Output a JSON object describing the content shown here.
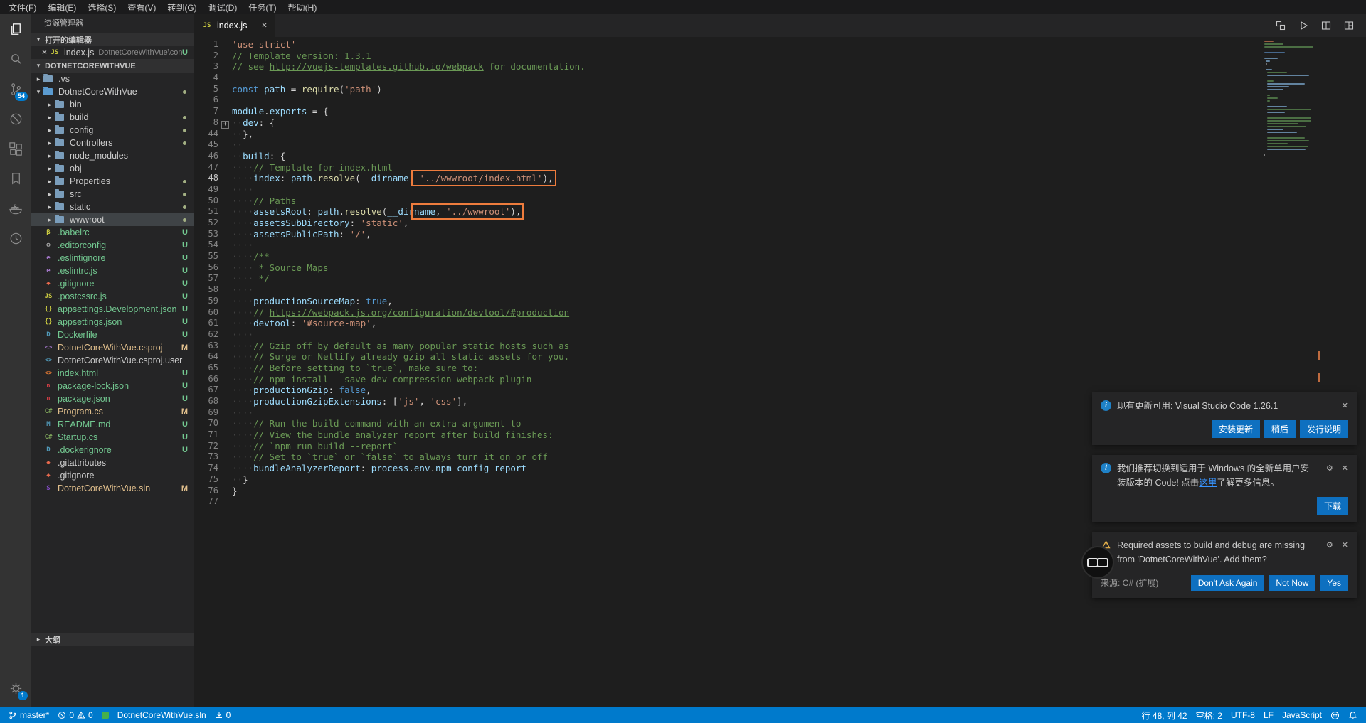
{
  "menu": {
    "items": [
      "文件(F)",
      "编辑(E)",
      "选择(S)",
      "查看(V)",
      "转到(G)",
      "调试(D)",
      "任务(T)",
      "帮助(H)"
    ]
  },
  "activity_bar": {
    "icons": [
      "explorer",
      "search",
      "source-control",
      "debug",
      "extensions",
      "bookmarks",
      "docker",
      "history",
      "settings"
    ],
    "scm_badge": "54",
    "settings_badge": "1"
  },
  "sidebar": {
    "title": "资源管理器",
    "open_editors_label": "打开的编辑器",
    "root_label": "DOTNETCOREWITHVUE",
    "outline_label": "大纲",
    "open_editor_item": {
      "file": "index.js",
      "path": "DotnetCoreWithVue\\con...",
      "badge": "U"
    },
    "tree": [
      {
        "l": ".vs",
        "d": 1,
        "k": "f",
        "tw": "▸",
        "ic": "folder"
      },
      {
        "l": "DotnetCoreWithVue",
        "d": 1,
        "k": "f",
        "tw": "▾",
        "ic": "folder-open",
        "dot": true
      },
      {
        "l": "bin",
        "d": 2,
        "k": "f",
        "tw": "▸",
        "ic": "folder"
      },
      {
        "l": "build",
        "d": 2,
        "k": "f",
        "tw": "▸",
        "ic": "folder",
        "dot": true
      },
      {
        "l": "config",
        "d": 2,
        "k": "f",
        "tw": "▸",
        "ic": "folder",
        "dot": true
      },
      {
        "l": "Controllers",
        "d": 2,
        "k": "f",
        "tw": "▸",
        "ic": "folder",
        "dot": true
      },
      {
        "l": "node_modules",
        "d": 2,
        "k": "f",
        "tw": "▸",
        "ic": "folder"
      },
      {
        "l": "obj",
        "d": 2,
        "k": "f",
        "tw": "▸",
        "ic": "folder"
      },
      {
        "l": "Properties",
        "d": 2,
        "k": "f",
        "tw": "▸",
        "ic": "folder",
        "dot": true
      },
      {
        "l": "src",
        "d": 2,
        "k": "f",
        "tw": "▸",
        "ic": "folder",
        "dot": true
      },
      {
        "l": "static",
        "d": 2,
        "k": "f",
        "tw": "▸",
        "ic": "folder",
        "dot": true
      },
      {
        "l": "wwwroot",
        "d": 2,
        "k": "f",
        "tw": "▸",
        "ic": "folder",
        "dot": true,
        "sel": true
      },
      {
        "l": ".babelrc",
        "d": 1,
        "k": "x",
        "ic": "babel",
        "b": "U",
        "g": "u"
      },
      {
        "l": ".editorconfig",
        "d": 1,
        "k": "x",
        "ic": "editorconfig",
        "b": "U",
        "g": "u"
      },
      {
        "l": ".eslintignore",
        "d": 1,
        "k": "x",
        "ic": "eslint",
        "b": "U",
        "g": "u"
      },
      {
        "l": ".eslintrc.js",
        "d": 1,
        "k": "x",
        "ic": "eslint",
        "b": "U",
        "g": "u"
      },
      {
        "l": ".gitignore",
        "d": 1,
        "k": "x",
        "ic": "git",
        "b": "U",
        "g": "u"
      },
      {
        "l": ".postcssrc.js",
        "d": 1,
        "k": "x",
        "ic": "js",
        "b": "U",
        "g": "u"
      },
      {
        "l": "appsettings.Development.json",
        "d": 1,
        "k": "x",
        "ic": "json",
        "b": "U",
        "g": "u"
      },
      {
        "l": "appsettings.json",
        "d": 1,
        "k": "x",
        "ic": "json",
        "b": "U",
        "g": "u"
      },
      {
        "l": "Dockerfile",
        "d": 1,
        "k": "x",
        "ic": "docker",
        "b": "U",
        "g": "u"
      },
      {
        "l": "DotnetCoreWithVue.csproj",
        "d": 1,
        "k": "x",
        "ic": "csproj",
        "b": "M",
        "g": "m"
      },
      {
        "l": "DotnetCoreWithVue.csproj.user",
        "d": 1,
        "k": "x",
        "ic": "csprojuser"
      },
      {
        "l": "index.html",
        "d": 1,
        "k": "x",
        "ic": "html",
        "b": "U",
        "g": "u"
      },
      {
        "l": "package-lock.json",
        "d": 1,
        "k": "x",
        "ic": "npm",
        "b": "U",
        "g": "u"
      },
      {
        "l": "package.json",
        "d": 1,
        "k": "x",
        "ic": "npm",
        "b": "U",
        "g": "u"
      },
      {
        "l": "Program.cs",
        "d": 1,
        "k": "x",
        "ic": "cs",
        "b": "M",
        "g": "m"
      },
      {
        "l": "README.md",
        "d": 1,
        "k": "x",
        "ic": "md",
        "b": "U",
        "g": "u"
      },
      {
        "l": "Startup.cs",
        "d": 1,
        "k": "x",
        "ic": "cs",
        "b": "U",
        "g": "u"
      },
      {
        "l": ".dockerignore",
        "d": 1,
        "k": "x",
        "ic": "docker",
        "b": "U",
        "g": "u"
      },
      {
        "l": ".gitattributes",
        "d": 1,
        "k": "x",
        "ic": "git"
      },
      {
        "l": ".gitignore",
        "d": 1,
        "k": "x",
        "ic": "git"
      },
      {
        "l": "DotnetCoreWithVue.sln",
        "d": 1,
        "k": "x",
        "ic": "sln",
        "b": "M",
        "g": "m"
      }
    ]
  },
  "editor": {
    "tab": {
      "label": "index.js"
    },
    "tab_actions": [
      "open-changes",
      "run",
      "split-editor",
      "layout"
    ],
    "cursor_line": 48,
    "code": [
      {
        "n": 1,
        "t": [
          [
            "s",
            "'use strict'"
          ]
        ]
      },
      {
        "n": 2,
        "t": [
          [
            "c",
            "// Template version: 1.3.1"
          ]
        ]
      },
      {
        "n": 3,
        "t": [
          [
            "c",
            "// see "
          ],
          [
            "cl",
            "http://vuejs-templates.github.io/webpack"
          ],
          [
            "c",
            " for documentation."
          ]
        ]
      },
      {
        "n": 4,
        "t": []
      },
      {
        "n": 5,
        "t": [
          [
            "k",
            "const"
          ],
          [
            "p",
            " "
          ],
          [
            "v",
            "path"
          ],
          [
            "p",
            " = "
          ],
          [
            "f",
            "require"
          ],
          [
            "p",
            "("
          ],
          [
            "s",
            "'path'"
          ],
          [
            "p",
            ")"
          ]
        ]
      },
      {
        "n": 6,
        "t": []
      },
      {
        "n": 7,
        "t": [
          [
            "v",
            "module"
          ],
          [
            "p",
            "."
          ],
          [
            "v",
            "exports"
          ],
          [
            "p",
            " = {"
          ]
        ]
      },
      {
        "n": 8,
        "fold": true,
        "t": [
          [
            "w",
            "  "
          ],
          [
            "v",
            "dev"
          ],
          [
            "p",
            ": {"
          ]
        ]
      },
      {
        "n": 44,
        "t": [
          [
            "w",
            "  "
          ],
          [
            "p",
            "},"
          ]
        ]
      },
      {
        "n": 45,
        "t": [
          [
            "w",
            "  "
          ]
        ]
      },
      {
        "n": 46,
        "t": [
          [
            "w",
            "  "
          ],
          [
            "v",
            "build"
          ],
          [
            "p",
            ": {"
          ]
        ]
      },
      {
        "n": 47,
        "t": [
          [
            "w",
            "    "
          ],
          [
            "c",
            "// Template for index.html"
          ]
        ]
      },
      {
        "n": 48,
        "caret": true,
        "t": [
          [
            "w",
            "    "
          ],
          [
            "v",
            "index"
          ],
          [
            "p",
            ": "
          ],
          [
            "v",
            "path"
          ],
          [
            "p",
            "."
          ],
          [
            "f",
            "resolve"
          ],
          [
            "p",
            "("
          ],
          [
            "v",
            "__dirname"
          ],
          [
            "p",
            ","
          ],
          [
            "p",
            " ",
            "b"
          ],
          [
            "s",
            "'../wwwroot/index.html'",
            "b"
          ],
          [
            "p",
            "),",
            "b"
          ]
        ]
      },
      {
        "n": 49,
        "t": [
          [
            "w",
            "    "
          ]
        ]
      },
      {
        "n": 50,
        "t": [
          [
            "w",
            "    "
          ],
          [
            "c",
            "// Paths"
          ]
        ]
      },
      {
        "n": 51,
        "t": [
          [
            "w",
            "    "
          ],
          [
            "v",
            "assetsRoot"
          ],
          [
            "p",
            ": "
          ],
          [
            "v",
            "path"
          ],
          [
            "p",
            "."
          ],
          [
            "f",
            "resolve"
          ],
          [
            "p",
            "("
          ],
          [
            "v",
            "__dir"
          ],
          [
            "v",
            "name",
            "b"
          ],
          [
            "p",
            ", ",
            "b"
          ],
          [
            "s",
            "'../wwwroot'",
            "b"
          ],
          [
            "p",
            "),",
            "b"
          ]
        ]
      },
      {
        "n": 52,
        "t": [
          [
            "w",
            "    "
          ],
          [
            "v",
            "assetsSubDirectory"
          ],
          [
            "p",
            ": "
          ],
          [
            "s",
            "'static'"
          ],
          [
            "p",
            ","
          ]
        ]
      },
      {
        "n": 53,
        "t": [
          [
            "w",
            "    "
          ],
          [
            "v",
            "assetsPublicPath"
          ],
          [
            "p",
            ": "
          ],
          [
            "s",
            "'/'"
          ],
          [
            "p",
            ","
          ]
        ]
      },
      {
        "n": 54,
        "t": [
          [
            "w",
            "    "
          ]
        ]
      },
      {
        "n": 55,
        "t": [
          [
            "w",
            "    "
          ],
          [
            "c",
            "/**"
          ]
        ]
      },
      {
        "n": 56,
        "t": [
          [
            "w",
            "    "
          ],
          [
            "c",
            " * Source Maps"
          ]
        ]
      },
      {
        "n": 57,
        "t": [
          [
            "w",
            "    "
          ],
          [
            "c",
            " */"
          ]
        ]
      },
      {
        "n": 58,
        "t": [
          [
            "w",
            "    "
          ]
        ]
      },
      {
        "n": 59,
        "t": [
          [
            "w",
            "    "
          ],
          [
            "v",
            "productionSourceMap"
          ],
          [
            "p",
            ": "
          ],
          [
            "k",
            "true"
          ],
          [
            "p",
            ","
          ]
        ]
      },
      {
        "n": 60,
        "t": [
          [
            "w",
            "    "
          ],
          [
            "c",
            "// "
          ],
          [
            "cl",
            "https://webpack.js.org/configuration/devtool/#production"
          ]
        ]
      },
      {
        "n": 61,
        "t": [
          [
            "w",
            "    "
          ],
          [
            "v",
            "devtool"
          ],
          [
            "p",
            ": "
          ],
          [
            "s",
            "'#source-map'"
          ],
          [
            "p",
            ","
          ]
        ]
      },
      {
        "n": 62,
        "t": [
          [
            "w",
            "    "
          ]
        ]
      },
      {
        "n": 63,
        "t": [
          [
            "w",
            "    "
          ],
          [
            "c",
            "// Gzip off by default as many popular static hosts such as"
          ]
        ]
      },
      {
        "n": 64,
        "t": [
          [
            "w",
            "    "
          ],
          [
            "c",
            "// Surge or Netlify already gzip all static assets for you."
          ]
        ]
      },
      {
        "n": 65,
        "t": [
          [
            "w",
            "    "
          ],
          [
            "c",
            "// Before setting to `true`, make sure to:"
          ]
        ]
      },
      {
        "n": 66,
        "t": [
          [
            "w",
            "    "
          ],
          [
            "c",
            "// npm install --save-dev compression-webpack-plugin"
          ]
        ]
      },
      {
        "n": 67,
        "t": [
          [
            "w",
            "    "
          ],
          [
            "v",
            "productionGzip"
          ],
          [
            "p",
            ": "
          ],
          [
            "k",
            "false"
          ],
          [
            "p",
            ","
          ]
        ]
      },
      {
        "n": 68,
        "t": [
          [
            "w",
            "    "
          ],
          [
            "v",
            "productionGzipExtensions"
          ],
          [
            "p",
            ": ["
          ],
          [
            "s",
            "'js'"
          ],
          [
            "p",
            ", "
          ],
          [
            "s",
            "'css'"
          ],
          [
            "p",
            "],"
          ]
        ]
      },
      {
        "n": 69,
        "t": [
          [
            "w",
            "    "
          ]
        ]
      },
      {
        "n": 70,
        "t": [
          [
            "w",
            "    "
          ],
          [
            "c",
            "// Run the build command with an extra argument to"
          ]
        ]
      },
      {
        "n": 71,
        "t": [
          [
            "w",
            "    "
          ],
          [
            "c",
            "// View the bundle analyzer report after build finishes:"
          ]
        ]
      },
      {
        "n": 72,
        "t": [
          [
            "w",
            "    "
          ],
          [
            "c",
            "// `npm run build --report`"
          ]
        ]
      },
      {
        "n": 73,
        "t": [
          [
            "w",
            "    "
          ],
          [
            "c",
            "// Set to `true` or `false` to always turn it on or off"
          ]
        ]
      },
      {
        "n": 74,
        "t": [
          [
            "w",
            "    "
          ],
          [
            "v",
            "bundleAnalyzerReport"
          ],
          [
            "p",
            ": "
          ],
          [
            "v",
            "process"
          ],
          [
            "p",
            "."
          ],
          [
            "v",
            "env"
          ],
          [
            "p",
            "."
          ],
          [
            "v",
            "npm_config_report"
          ]
        ]
      },
      {
        "n": 75,
        "t": [
          [
            "w",
            "  "
          ],
          [
            "p",
            "}"
          ]
        ]
      },
      {
        "n": 76,
        "t": [
          [
            "p",
            "}"
          ]
        ]
      },
      {
        "n": 77,
        "t": []
      }
    ]
  },
  "notifications": [
    {
      "type": "info",
      "message": "现有更新可用: Visual Studio Code 1.26.1",
      "buttons": [
        "安装更新",
        "稍后",
        "发行说明"
      ]
    },
    {
      "type": "info",
      "message_before": "我们推荐切换到适用于 Windows 的全新单用户安装版本的 Code! 点击",
      "link": "这里",
      "message_after": "了解更多信息。",
      "buttons": [
        "下载"
      ]
    },
    {
      "type": "warning",
      "message": "Required assets to build and debug are missing from 'DotnetCoreWithVue'. Add them?",
      "source": "来源: C# (扩展)",
      "buttons": [
        "Don't Ask Again",
        "Not Now",
        "Yes"
      ]
    }
  ],
  "status_bar": {
    "branch": "master*",
    "errors": "0",
    "warnings": "0",
    "solution": "DotnetCoreWithVue.sln",
    "tasks": "0",
    "cursor": "行 48, 列 42",
    "indent": "空格: 2",
    "encoding": "UTF-8",
    "eol": "LF",
    "language": "JavaScript"
  }
}
